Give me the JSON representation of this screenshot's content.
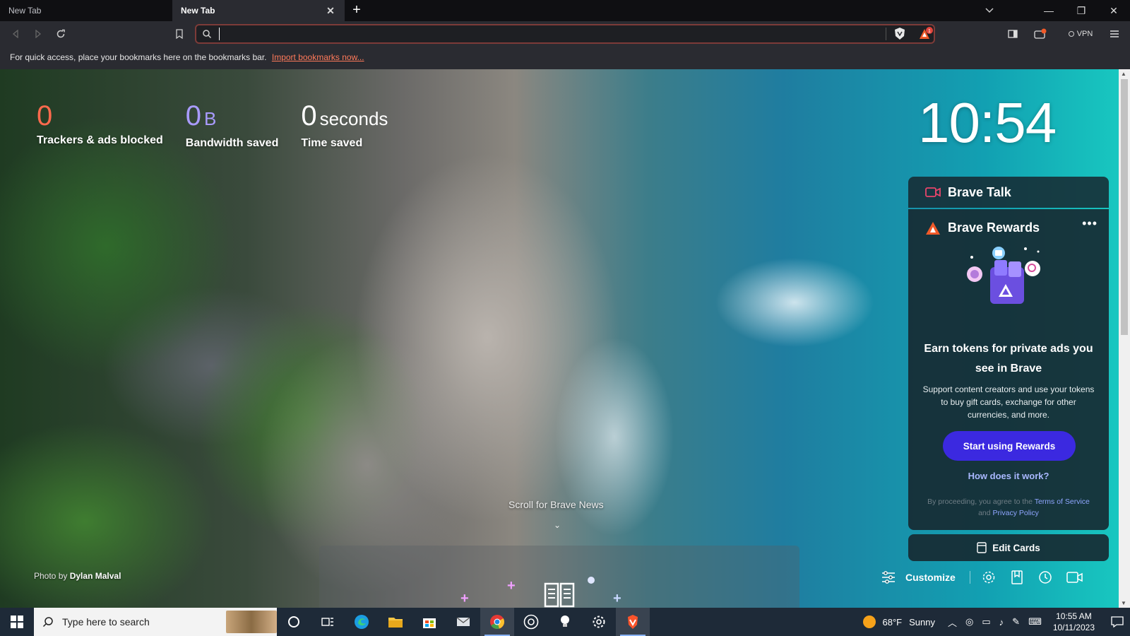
{
  "tabs": [
    {
      "label": "New Tab",
      "active": false
    },
    {
      "label": "New Tab",
      "active": true
    }
  ],
  "omnibox": {
    "value": "",
    "placeholder": ""
  },
  "toolbar": {
    "vpn_label": "VPN",
    "rewards_badge": "1"
  },
  "bookmarks_bar": {
    "text": "For quick access, place your bookmarks here on the bookmarks bar.",
    "link": "Import bookmarks now..."
  },
  "stats": [
    {
      "value": "0",
      "unit": "",
      "label": "Trackers & ads blocked",
      "color": "#ff6a4d"
    },
    {
      "value": "0",
      "unit": "B",
      "label": "Bandwidth saved",
      "color": "#a99bff"
    },
    {
      "value": "0",
      "unit": "seconds",
      "label": "Time saved",
      "color": "#ffffff"
    }
  ],
  "clock": "10:54",
  "brave_talk": {
    "title": "Brave Talk"
  },
  "rewards": {
    "title": "Brave Rewards",
    "headline": "Earn tokens for private ads you see in Brave",
    "description": "Support content creators and use your tokens to buy gift cards, exchange for other currencies, and more.",
    "cta": "Start using Rewards",
    "how": "How does it work?",
    "legal_prefix": "By proceeding, you agree to the",
    "terms": "Terms of Service",
    "and": "and",
    "privacy": "Privacy Policy"
  },
  "edit_cards": "Edit Cards",
  "customize": "Customize",
  "photo_credit": {
    "prefix": "Photo by",
    "name": "Dylan Malval"
  },
  "scroll_news": "Scroll for Brave News",
  "taskbar": {
    "search_placeholder": "Type here to search",
    "weather_temp": "68°F",
    "weather_cond": "Sunny",
    "time": "10:55 AM",
    "date": "10/11/2023"
  },
  "colors": {
    "accent": "#3b29e0",
    "omnibox_border": "#7d3b38",
    "tracker_count": "#ff6a4d"
  }
}
